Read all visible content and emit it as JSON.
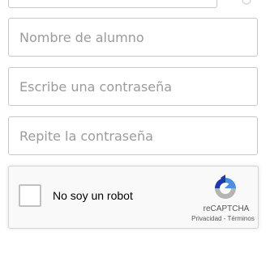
{
  "form": {
    "username_placeholder": "Nombre de alumno",
    "password_placeholder": "Escribe una contraseña",
    "repeat_password_placeholder": "Repite la contraseña"
  },
  "recaptcha": {
    "checkbox_label": "No soy un robot",
    "brand": "reCAPTCHA",
    "privacy_link": "Privacidad",
    "separator": " - ",
    "terms_link": "Términos",
    "logo_icon": "recaptcha-logo-icon",
    "colors": {
      "blue": "#4a90e2",
      "dark_blue": "#1c3aa9",
      "gray": "#b4b4b4"
    }
  }
}
